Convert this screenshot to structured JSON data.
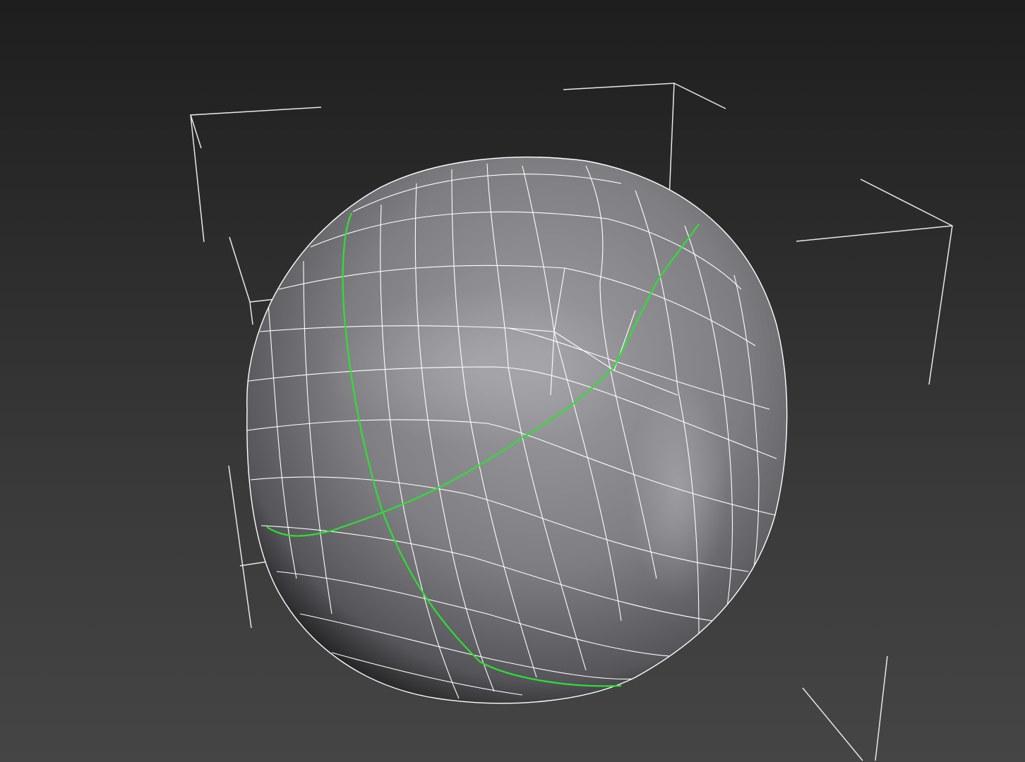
{
  "viewport": {
    "background_top": "#1e1e1e",
    "background_bottom": "#454545"
  },
  "object": {
    "shape": "sphere",
    "display": "shaded-wireframe",
    "mesh_color": "#8e8e92",
    "wire_color": "#ffffff",
    "selected_edge_color": "#2de032",
    "bbox_bracket_color": "#e8e8e8",
    "selected_edge_loops": 2
  },
  "icons": {
    "bbox": "selection-bracket-icon"
  }
}
